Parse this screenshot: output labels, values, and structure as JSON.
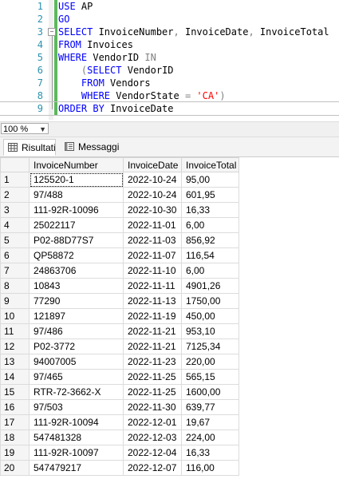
{
  "editor": {
    "lines": [
      {
        "n": "1",
        "parts": [
          {
            "t": "USE",
            "c": "kw"
          },
          {
            "t": " AP",
            "c": "txt"
          }
        ]
      },
      {
        "n": "2",
        "parts": [
          {
            "t": "GO",
            "c": "kw"
          }
        ]
      },
      {
        "n": "3",
        "parts": [
          {
            "t": "SELECT",
            "c": "kw"
          },
          {
            "t": " InvoiceNumber",
            "c": "txt"
          },
          {
            "t": ",",
            "c": "op"
          },
          {
            "t": " InvoiceDate",
            "c": "txt"
          },
          {
            "t": ",",
            "c": "op"
          },
          {
            "t": " InvoiceTotal",
            "c": "txt"
          }
        ]
      },
      {
        "n": "4",
        "parts": [
          {
            "t": "FROM",
            "c": "kw"
          },
          {
            "t": " Invoices",
            "c": "txt"
          }
        ]
      },
      {
        "n": "5",
        "parts": [
          {
            "t": "WHERE",
            "c": "kw"
          },
          {
            "t": " VendorID ",
            "c": "txt"
          },
          {
            "t": "IN",
            "c": "gr"
          }
        ]
      },
      {
        "n": "6",
        "parts": [
          {
            "t": "    ",
            "c": "txt"
          },
          {
            "t": "(",
            "c": "gr"
          },
          {
            "t": "SELECT",
            "c": "kw"
          },
          {
            "t": " VendorID",
            "c": "txt"
          }
        ]
      },
      {
        "n": "7",
        "parts": [
          {
            "t": "    ",
            "c": "txt"
          },
          {
            "t": "FROM",
            "c": "kw"
          },
          {
            "t": " Vendors",
            "c": "txt"
          }
        ]
      },
      {
        "n": "8",
        "parts": [
          {
            "t": "    ",
            "c": "txt"
          },
          {
            "t": "WHERE",
            "c": "kw"
          },
          {
            "t": " VendorState ",
            "c": "txt"
          },
          {
            "t": "=",
            "c": "gr"
          },
          {
            "t": " 'CA'",
            "c": "str"
          },
          {
            "t": ")",
            "c": "gr"
          }
        ]
      },
      {
        "n": "9",
        "parts": [
          {
            "t": "ORDER BY",
            "c": "kw"
          },
          {
            "t": " InvoiceDate",
            "c": "txt"
          }
        ]
      }
    ]
  },
  "zoom": {
    "value": "100 %"
  },
  "tabs": {
    "results": "Risultati",
    "messages": "Messaggi"
  },
  "grid": {
    "columns": [
      "InvoiceNumber",
      "InvoiceDate",
      "InvoiceTotal"
    ],
    "rows": [
      [
        "1",
        "125520-1",
        "2022-10-24",
        "95,00"
      ],
      [
        "2",
        "97/488",
        "2022-10-24",
        "601,95"
      ],
      [
        "3",
        "111-92R-10096",
        "2022-10-30",
        "16,33"
      ],
      [
        "4",
        "25022117",
        "2022-11-01",
        "6,00"
      ],
      [
        "5",
        "P02-88D77S7",
        "2022-11-03",
        "856,92"
      ],
      [
        "6",
        "QP58872",
        "2022-11-07",
        "116,54"
      ],
      [
        "7",
        "24863706",
        "2022-11-10",
        "6,00"
      ],
      [
        "8",
        "10843",
        "2022-11-11",
        "4901,26"
      ],
      [
        "9",
        "77290",
        "2022-11-13",
        "1750,00"
      ],
      [
        "10",
        "121897",
        "2022-11-19",
        "450,00"
      ],
      [
        "11",
        "97/486",
        "2022-11-21",
        "953,10"
      ],
      [
        "12",
        "P02-3772",
        "2022-11-21",
        "7125,34"
      ],
      [
        "13",
        "94007005",
        "2022-11-23",
        "220,00"
      ],
      [
        "14",
        "97/465",
        "2022-11-25",
        "565,15"
      ],
      [
        "15",
        "RTR-72-3662-X",
        "2022-11-25",
        "1600,00"
      ],
      [
        "16",
        "97/503",
        "2022-11-30",
        "639,77"
      ],
      [
        "17",
        "111-92R-10094",
        "2022-12-01",
        "19,67"
      ],
      [
        "18",
        "547481328",
        "2022-12-03",
        "224,00"
      ],
      [
        "19",
        "111-92R-10097",
        "2022-12-04",
        "16,33"
      ],
      [
        "20",
        "547479217",
        "2022-12-07",
        "116,00"
      ]
    ]
  }
}
